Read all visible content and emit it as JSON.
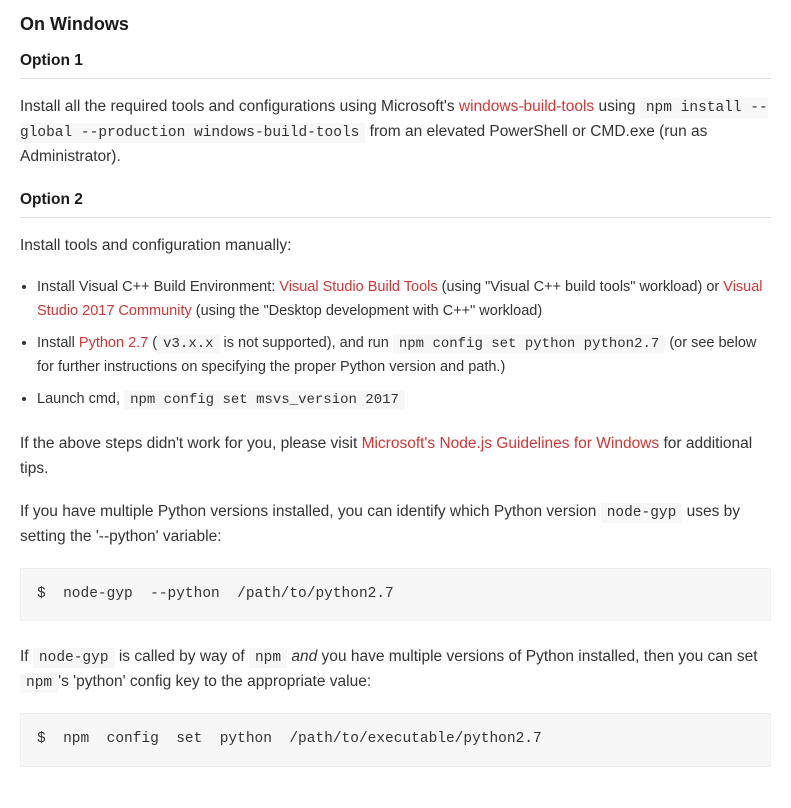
{
  "heading_windows": "On Windows",
  "option1": {
    "heading": "Option 1",
    "para": {
      "t1": "Install all the required tools and configurations using Microsoft's ",
      "link1": "windows-build-tools",
      "t2": " using ",
      "code1": "npm install --global --production windows-build-tools",
      "t3": " from an elevated PowerShell or CMD.exe (run as Administrator)."
    }
  },
  "option2": {
    "heading": "Option 2",
    "intro": "Install tools and configuration manually:",
    "bullets": {
      "b1": {
        "t1": "Install Visual C++ Build Environment: ",
        "link1": "Visual Studio Build Tools",
        "t2": " (using \"Visual C++ build tools\" workload) or ",
        "link2": "Visual Studio 2017 Community",
        "t3": " (using the \"Desktop development with C++\" workload)"
      },
      "b2": {
        "t1": "Install ",
        "link1": "Python 2.7",
        "t2": " (",
        "code1": "v3.x.x",
        "t3": " is not supported), and run ",
        "code2": "npm config set python python2.7",
        "t4": " (or see below for further instructions on specifying the proper Python version and path.)"
      },
      "b3": {
        "t1": "Launch cmd, ",
        "code1": "npm config set msvs_version 2017"
      }
    },
    "after1": {
      "t1": "If the above steps didn't work for you, please visit ",
      "link1": "Microsoft's Node.js Guidelines for Windows",
      "t2": " for additional tips."
    },
    "after2": {
      "t1": "If you have multiple Python versions installed, you can identify which Python version ",
      "code1": "node-gyp",
      "t2": " uses by setting the '--python' variable:"
    },
    "codeblock1": "$  node-gyp  --python  /path/to/python2.7",
    "after3": {
      "t1": "If ",
      "code1": "node-gyp",
      "t2": " is called by way of ",
      "code2": "npm",
      "t3": " ",
      "em1": "and",
      "t4": " you have multiple versions of Python installed, then you can set ",
      "code3": "npm",
      "t5": "'s 'python' config key to the appropriate value:"
    },
    "codeblock2": "$  npm  config  set  python  /path/to/executable/python2.7"
  }
}
